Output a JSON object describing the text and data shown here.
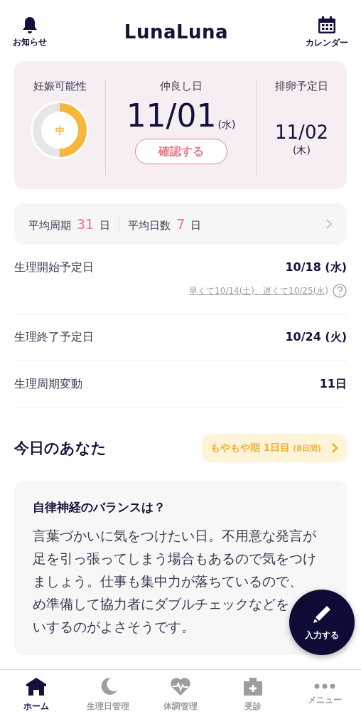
{
  "header": {
    "left": {
      "label": "お知らせ"
    },
    "logo": "LunaLuna",
    "right": {
      "label": "カレンダー"
    }
  },
  "summary": {
    "chance": {
      "label": "妊娠可能性",
      "value": "中",
      "level": 0.5
    },
    "best_day": {
      "label": "仲良し日",
      "date": "11/01",
      "weekday": "(水)",
      "button": "確認する"
    },
    "ovulation": {
      "label": "排卵予定日",
      "date": "11/02",
      "weekday": "(木)"
    }
  },
  "averages": [
    {
      "label": "平均周期",
      "value": "31",
      "unit": "日"
    },
    {
      "label": "平均日数",
      "value": "7",
      "unit": "日"
    }
  ],
  "rows": [
    {
      "label": "生理開始予定日",
      "value": "10/18 (水)",
      "note": "早くて10/14(土)、遅くて10/25(水)"
    },
    {
      "label": "生理終了予定日",
      "value": "10/24 (火)"
    },
    {
      "label": "生理周期変動",
      "value": "11日"
    }
  ],
  "today": {
    "title": "今日のあなた",
    "phase": {
      "name": "もやもや期",
      "day": "1日目",
      "span": "(8日間)"
    },
    "card": {
      "heading": "自律神経のバランスは？",
      "lines": [
        "言葉づかいに気をつけたい日。不用意な発言が",
        "足を引っ張ってしまう場合もあるので気をつけ",
        "ましょう。仕事も集中力が落ちているので、",
        "め準備して協力者にダブルチェックなどを",
        "いするのがよさそうです。"
      ]
    }
  },
  "fab": {
    "label": "入力する"
  },
  "nav": [
    {
      "label": "ホーム",
      "selected": true
    },
    {
      "label": "生理日管理",
      "selected": false
    },
    {
      "label": "体調管理",
      "selected": false
    },
    {
      "label": "受診",
      "selected": false
    },
    {
      "label": "メニュー",
      "selected": false
    }
  ]
}
